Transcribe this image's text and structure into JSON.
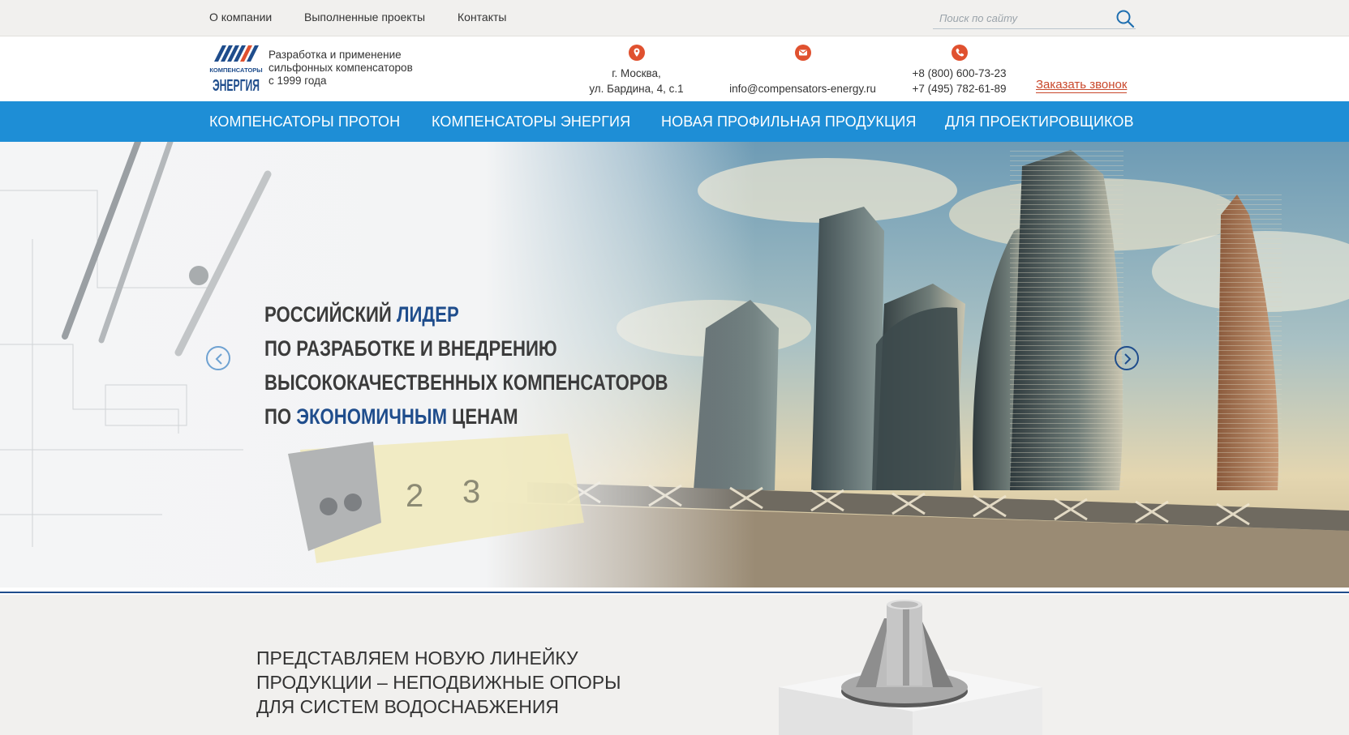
{
  "topnav": {
    "items": [
      "О компании",
      "Выполненные проекты",
      "Контакты"
    ],
    "search_placeholder": "Поиск по сайту"
  },
  "header": {
    "logo_text_small": "КОМПЕНСАТОРЫ",
    "logo_text_big": "ЭНЕРГИЯ",
    "tagline": [
      "Разработка и применение",
      "сильфонных компенсаторов",
      "с 1999 года"
    ],
    "address": [
      "г. Москва,",
      "ул. Бардина, 4, с.1"
    ],
    "email": "info@compensators-energy.ru",
    "phones": [
      "+8 (800) 600-73-23",
      "+7 (495) 782-61-89"
    ],
    "callback": "Заказать звонок",
    "icons": [
      "location-icon",
      "mail-icon",
      "phone-icon"
    ]
  },
  "mainnav": [
    "Компенсаторы ПРОТОН",
    "Компенсаторы ЭНЕРГИЯ",
    "Новая профильная продукция",
    "Для проектировщиков"
  ],
  "hero": {
    "line1_a": "Российский ",
    "line1_b": "лидер",
    "line2": "по разработке и внедрению",
    "line3": "высококачественных компенсаторов",
    "line4_a": "по ",
    "line4_b": "экономичным",
    "line4_c": " ценам",
    "ruler_marks": [
      "2",
      "3"
    ]
  },
  "promo": {
    "lines": [
      "Представляем новую линейку",
      "продукции – неподвижные опоры",
      "для систем водоснабжения"
    ]
  },
  "colors": {
    "accent": "#1e8ed6",
    "dark_blue": "#1f4d8c",
    "contact_icon": "#e0512f",
    "callback": "#c9482c"
  }
}
